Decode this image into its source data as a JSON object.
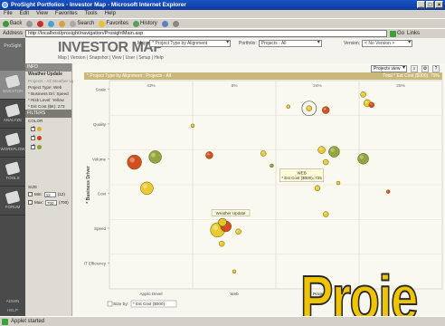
{
  "window": {
    "title": "ProSight Portfolios - Investor Map - Microsoft Internet Explorer",
    "buttons": [
      "_",
      "□",
      "×"
    ]
  },
  "menu": [
    "File",
    "Edit",
    "View",
    "Favorites",
    "Tools",
    "Help"
  ],
  "toolbar": {
    "back": "Back",
    "search": "Search",
    "favorites": "Favorites",
    "history": "History"
  },
  "address": {
    "label": "Address",
    "url": "http://localhost/prosight/navigation/ProsightMain.asp",
    "go": "Go",
    "links": "Links"
  },
  "rail": {
    "logo": "ProSight",
    "items": [
      "INVESTOR",
      "ANALYZE",
      "WORKFLOW",
      "TOOLS",
      "FORUM"
    ],
    "admin": "ADMIN",
    "help": "HELP"
  },
  "header": {
    "brand": "INVESTOR MAP",
    "nav": "Map  |  Version  |  Snapshot  |  View  |  User  |  Setup  |  Help",
    "map_label": "Map:",
    "map_value": "* Project Type by Alignment",
    "portfolio_label": "Portfolio:",
    "portfolio_value": "Projects - All",
    "version_label": "Version:",
    "version_value": "< No Version >",
    "view_mode": "Projects view mode"
  },
  "panel": {
    "info_header": "INFO",
    "info_title": "Weather Update",
    "info_sub": "Projects - All Weather Update",
    "info_lines": [
      "Project Type: Web",
      "* Business Dri: Speed",
      "* Risk Level: Yellow",
      "* Est Cost ($K): 273"
    ],
    "filters_header": "FILTERS",
    "color_label": "COLOR",
    "colors": [
      "#e0b020",
      "#d04010",
      "#8aa030"
    ],
    "size_label": "SIZE",
    "size_rows": [
      {
        "label": "Min:",
        "value": "12",
        "hint": "(12)"
      },
      {
        "label": "Max:",
        "value": "700",
        "hint": "(700)"
      }
    ]
  },
  "chart_data": {
    "type": "scatter",
    "title": "* Project Type by Alignment : Projects - All",
    "total_label": "Total * Est Cost ($000): 79%",
    "column_percents": [
      "43%",
      "8%",
      "24%",
      "25%"
    ],
    "y_axis_title": "* Business Driver",
    "y_categories": [
      "Scale",
      "Quality",
      "Volume",
      "Cost",
      "Speed",
      "IT Efficiency"
    ],
    "x_categories": [
      "Applic Devel",
      "Web",
      "Project T"
    ],
    "size_by": "Size by:",
    "size_by_value": "* Est Cost ($000)",
    "tooltip": {
      "title": "WEB",
      "value": "* Est Cost ($000)=725"
    },
    "callout": "Weather Update",
    "bubbles": [
      {
        "col": 0.3,
        "row": 2.35,
        "size": 8,
        "color": "#d04010"
      },
      {
        "col": 0.55,
        "row": 2.2,
        "size": 7,
        "color": "#8aa030"
      },
      {
        "col": 0.45,
        "row": 3.1,
        "size": 7,
        "color": "#e8c820"
      },
      {
        "col": 1.0,
        "row": 1.3,
        "size": 2,
        "color": "#e8c820"
      },
      {
        "col": 1.2,
        "row": 2.15,
        "size": 4,
        "color": "#d04010"
      },
      {
        "col": 1.85,
        "row": 2.1,
        "size": 3,
        "color": "#e8c820"
      },
      {
        "col": 1.95,
        "row": 2.45,
        "size": 2,
        "color": "#8aa030"
      },
      {
        "col": 1.3,
        "row": 4.3,
        "size": 8,
        "color": "#e8c820"
      },
      {
        "col": 1.4,
        "row": 4.2,
        "size": 6,
        "color": "#d04010"
      },
      {
        "col": 1.35,
        "row": 4.7,
        "size": 3,
        "color": "#e8c820"
      },
      {
        "col": 1.55,
        "row": 4.35,
        "size": 3,
        "color": "#e8c820"
      },
      {
        "col": 1.5,
        "row": 5.5,
        "size": 2,
        "color": "#e8c820"
      },
      {
        "col": 2.15,
        "row": 0.75,
        "size": 2,
        "color": "#e8c820"
      },
      {
        "col": 2.4,
        "row": 0.8,
        "size": 3,
        "color": "#e8c820"
      },
      {
        "col": 2.6,
        "row": 0.85,
        "size": 4,
        "color": "#d04010"
      },
      {
        "col": 2.55,
        "row": 2.0,
        "size": 4,
        "color": "#e8c820"
      },
      {
        "col": 2.6,
        "row": 2.35,
        "size": 3,
        "color": "#e8c820"
      },
      {
        "col": 2.7,
        "row": 2.05,
        "size": 6,
        "color": "#8aa030"
      },
      {
        "col": 3.05,
        "row": 0.4,
        "size": 3,
        "color": "#e8c820"
      },
      {
        "col": 3.1,
        "row": 0.65,
        "size": 4,
        "color": "#e8c820"
      },
      {
        "col": 3.15,
        "row": 0.7,
        "size": 3,
        "color": "#d04010"
      },
      {
        "col": 3.05,
        "row": 2.25,
        "size": 6,
        "color": "#8aa030"
      },
      {
        "col": 2.5,
        "row": 3.1,
        "size": 3,
        "color": "#e8c820"
      },
      {
        "col": 2.75,
        "row": 2.95,
        "size": 2,
        "color": "#e8c820"
      },
      {
        "col": 3.35,
        "row": 3.2,
        "size": 2,
        "color": "#d04010"
      },
      {
        "col": 2.6,
        "row": 3.85,
        "size": 3,
        "color": "#e8c820"
      }
    ]
  },
  "overlay_word": "Proje",
  "status": "Applet started"
}
